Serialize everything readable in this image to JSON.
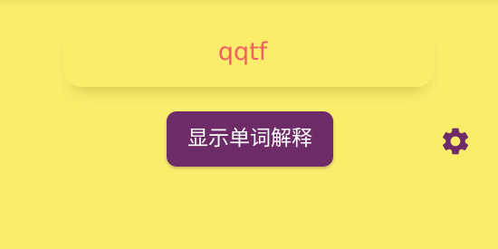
{
  "word": "qqtf",
  "buttons": {
    "show_definition": "显示单词解释"
  },
  "icons": {
    "settings": "gear-icon"
  },
  "colors": {
    "background": "#fbec6c",
    "word": "#f06060",
    "button": "#6d2b68",
    "button_text": "#ffffff",
    "settings_icon": "#6d2b68"
  }
}
